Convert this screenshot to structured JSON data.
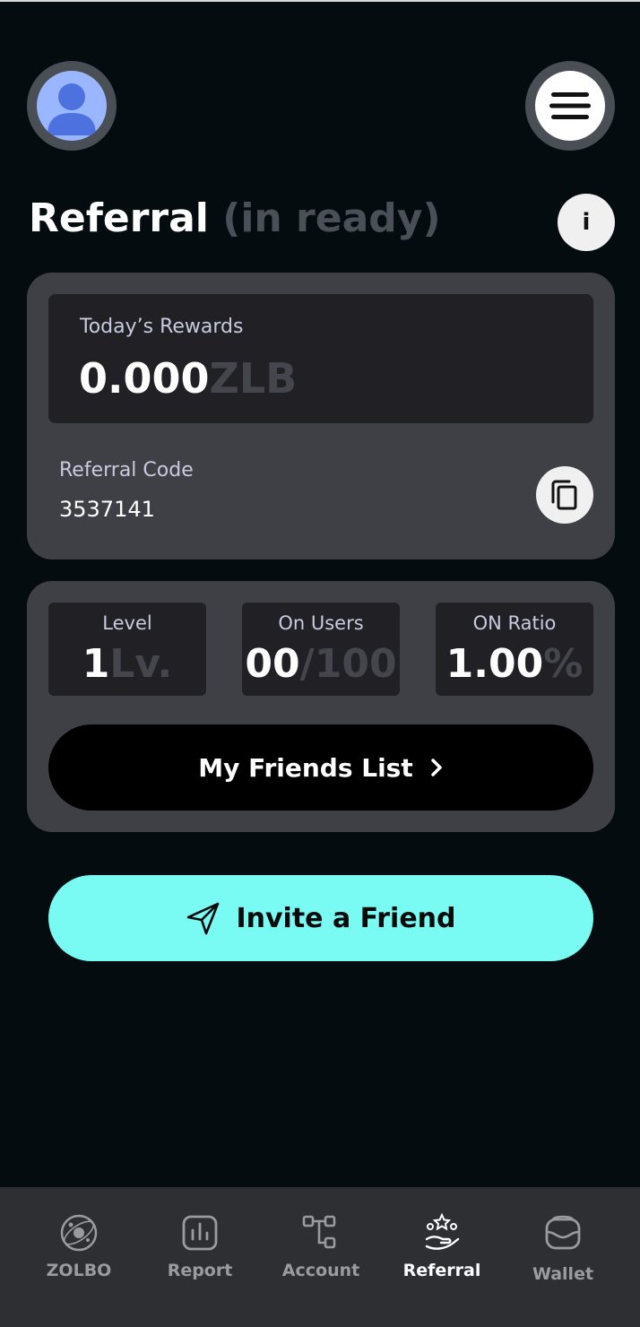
{
  "header": {
    "avatar_icon": "user-avatar-icon",
    "menu_icon": "hamburger-menu-icon"
  },
  "page": {
    "title": "Referral",
    "subtitle": "(in ready)",
    "info_label": "i"
  },
  "rewards": {
    "label": "Today’s Rewards",
    "value": "0.000",
    "unit": "ZLB"
  },
  "referral_code": {
    "label": "Referral Code",
    "value": "3537141",
    "copy_icon": "copy-icon"
  },
  "stats": {
    "level": {
      "label": "Level",
      "value": "1",
      "unit": "Lv."
    },
    "on_users": {
      "label": "On Users",
      "value": "00",
      "unit": "/100"
    },
    "on_ratio": {
      "label": "ON Ratio",
      "value": "1.00",
      "unit": "%"
    }
  },
  "friends_button": {
    "label": "My Friends List",
    "icon": "chevron-right-icon"
  },
  "invite_button": {
    "label": "Invite a Friend",
    "icon": "send-icon"
  },
  "bottom_nav": {
    "items": [
      {
        "label": "ZOLBO",
        "icon": "globe-icon",
        "active": false
      },
      {
        "label": "Report",
        "icon": "bar-chart-icon",
        "active": false
      },
      {
        "label": "Account",
        "icon": "account-tree-icon",
        "active": false
      },
      {
        "label": "Referral",
        "icon": "referral-stars-hand-icon",
        "active": true
      },
      {
        "label": "Wallet",
        "icon": "wallet-icon",
        "active": false
      }
    ]
  },
  "colors": {
    "background": "#050c10",
    "card": "#3f3f46",
    "inner_box": "#202025",
    "accent": "#79fbf4",
    "muted_text": "#45464d",
    "label_text": "#c7cbe0"
  }
}
